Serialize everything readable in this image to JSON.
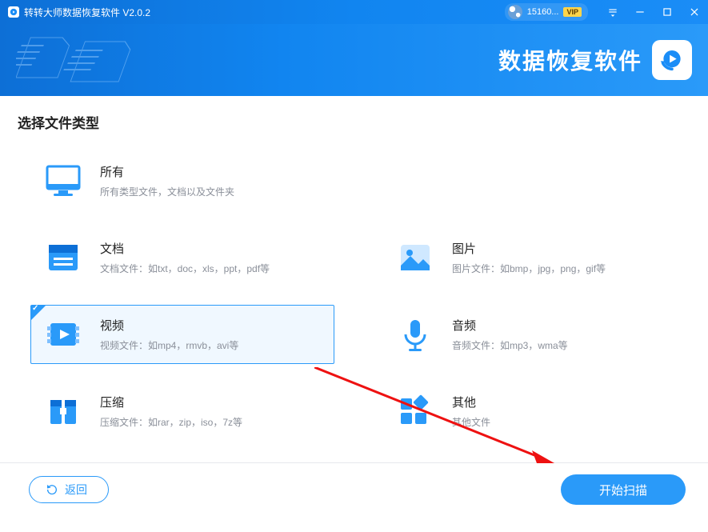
{
  "titlebar": {
    "app_title": "转转大师数据恢复软件 V2.0.2",
    "user_id": "15160...",
    "vip_label": "VIP"
  },
  "banner": {
    "brand_text": "数据恢复软件"
  },
  "section_title": "选择文件类型",
  "tiles": {
    "all": {
      "title": "所有",
      "desc": "所有类型文件，文档以及文件夹"
    },
    "doc": {
      "title": "文档",
      "desc": "文档文件：如txt，doc，xls，ppt，pdf等"
    },
    "image": {
      "title": "图片",
      "desc": "图片文件：如bmp，jpg，png，gif等"
    },
    "video": {
      "title": "视频",
      "desc": "视频文件：如mp4，rmvb，avi等"
    },
    "audio": {
      "title": "音频",
      "desc": "音频文件：如mp3，wma等"
    },
    "archive": {
      "title": "压缩",
      "desc": "压缩文件：如rar，zip，iso，7z等"
    },
    "other": {
      "title": "其他",
      "desc": "其他文件"
    }
  },
  "footer": {
    "back_label": "返回",
    "scan_label": "开始扫描"
  }
}
